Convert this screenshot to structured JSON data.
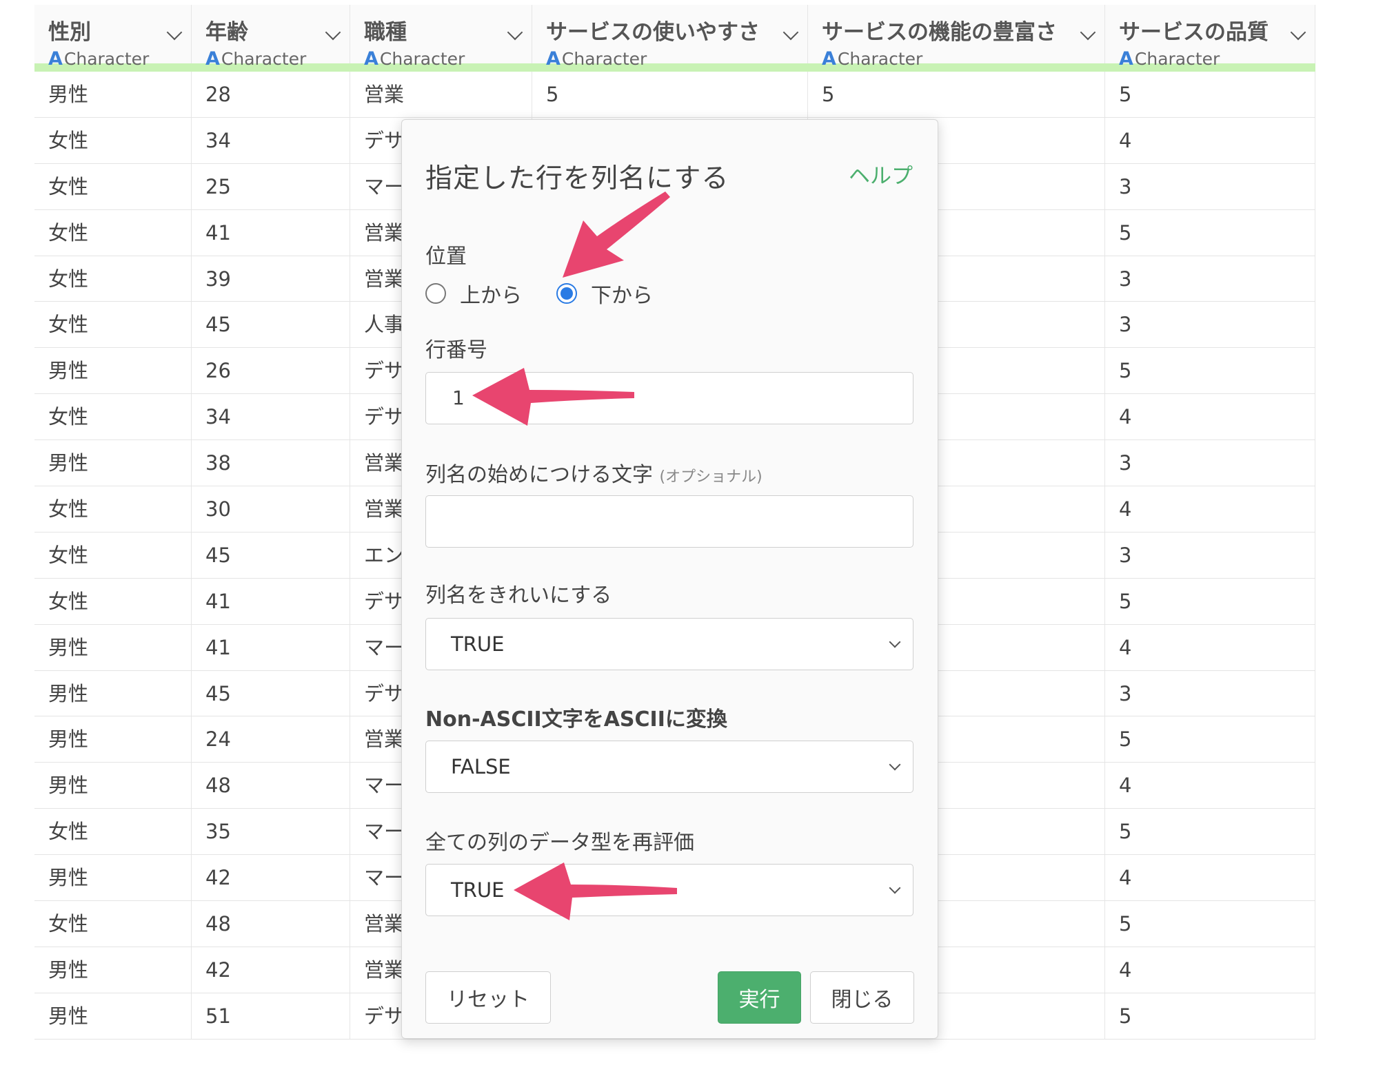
{
  "columns": [
    {
      "name": "性別",
      "type": "Character"
    },
    {
      "name": "年齢",
      "type": "Character"
    },
    {
      "name": "職種",
      "type": "Character"
    },
    {
      "name": "サービスの使いやすさ",
      "type": "Character"
    },
    {
      "name": "サービスの機能の豊富さ",
      "type": "Character"
    },
    {
      "name": "サービスの品質",
      "type": "Character"
    }
  ],
  "type_icon": "A",
  "rows": [
    [
      "男性",
      "28",
      "営業",
      "5",
      "5",
      "5"
    ],
    [
      "女性",
      "34",
      "デサ",
      "",
      "",
      "4"
    ],
    [
      "女性",
      "25",
      "マー",
      "",
      "",
      "3"
    ],
    [
      "女性",
      "41",
      "営業",
      "",
      "",
      "5"
    ],
    [
      "女性",
      "39",
      "営業",
      "",
      "",
      "3"
    ],
    [
      "女性",
      "45",
      "人事",
      "",
      "",
      "3"
    ],
    [
      "男性",
      "26",
      "デサ",
      "",
      "",
      "5"
    ],
    [
      "女性",
      "34",
      "デサ",
      "",
      "",
      "4"
    ],
    [
      "男性",
      "38",
      "営業",
      "",
      "",
      "3"
    ],
    [
      "女性",
      "30",
      "営業",
      "",
      "",
      "4"
    ],
    [
      "女性",
      "45",
      "エン",
      "",
      "",
      "3"
    ],
    [
      "女性",
      "41",
      "デサ",
      "",
      "",
      "5"
    ],
    [
      "男性",
      "41",
      "マー",
      "",
      "",
      "4"
    ],
    [
      "男性",
      "45",
      "デサ",
      "",
      "",
      "3"
    ],
    [
      "男性",
      "24",
      "営業",
      "",
      "",
      "5"
    ],
    [
      "男性",
      "48",
      "マー",
      "",
      "",
      "4"
    ],
    [
      "女性",
      "35",
      "マー",
      "",
      "",
      "5"
    ],
    [
      "男性",
      "42",
      "マー",
      "",
      "",
      "4"
    ],
    [
      "女性",
      "48",
      "営業",
      "",
      "",
      "5"
    ],
    [
      "男性",
      "42",
      "営業",
      "",
      "",
      "4"
    ],
    [
      "男性",
      "51",
      "デサ",
      "",
      "",
      "5"
    ]
  ],
  "dialog": {
    "title": "指定した行を列名にする",
    "help": "ヘルプ",
    "position_label": "位置",
    "position_options": [
      "上から",
      "下から"
    ],
    "position_selected": "下から",
    "row_number_label": "行番号",
    "row_number_value": "1",
    "prefix_label": "列名の始めにつける文字",
    "prefix_optional": "(オプショナル)",
    "prefix_value": "",
    "clean_names_label": "列名をきれいにする",
    "clean_names_value": "TRUE",
    "ascii_label": "Non-ASCII文字をASCIIに変換",
    "ascii_value": "FALSE",
    "reeval_label": "全ての列のデータ型を再評価",
    "reeval_value": "TRUE",
    "reset_button": "リセット",
    "run_button": "実行",
    "close_button": "閉じる"
  },
  "colors": {
    "header_accent": "#c8f2b4",
    "primary_green": "#4caf6e",
    "radio_blue": "#2a7be4",
    "annotation_arrow": "#e8456f"
  }
}
